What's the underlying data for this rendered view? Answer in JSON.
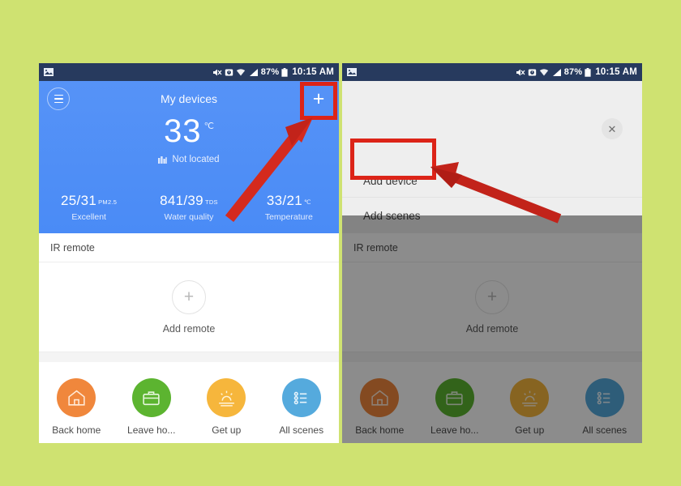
{
  "background_color": "#cfe271",
  "accent_red": "#dc2418",
  "status_bar": {
    "icons": [
      "image-icon",
      "mute-icon",
      "alarm-icon",
      "wifi-icon",
      "signal-icon"
    ],
    "battery_percent": "87%",
    "battery_icon": "battery-icon",
    "time": "10:15 AM"
  },
  "left_phone": {
    "header": {
      "menu_icon": "hamburger-menu-icon",
      "title": "My devices",
      "add_icon": "plus-icon",
      "temperature": "33",
      "temperature_unit": "℃",
      "location_icon": "city-icon",
      "location_text": "Not located",
      "stats": [
        {
          "value": "25/31",
          "unit": "PM2.5",
          "label": "Excellent"
        },
        {
          "value": "841/39",
          "unit": "TDS",
          "label": "Water quality"
        },
        {
          "value": "33/21",
          "unit": "℃",
          "label": "Temperature"
        }
      ]
    },
    "section_title": "IR remote",
    "add_remote": {
      "icon": "plus-icon",
      "label": "Add remote"
    },
    "scenes": [
      {
        "name": "Back home",
        "icon": "home-icon",
        "color": "#f0873c"
      },
      {
        "name": "Leave ho...",
        "icon": "briefcase-icon",
        "color": "#5cb430"
      },
      {
        "name": "Get up",
        "icon": "sunrise-icon",
        "color": "#f6b63c"
      },
      {
        "name": "All scenes",
        "icon": "list-icon",
        "color": "#55aadd"
      }
    ]
  },
  "right_phone": {
    "close_icon": "close-icon",
    "menu_items": [
      {
        "label": "Add device",
        "highlighted": true
      },
      {
        "label": "Add scenes",
        "highlighted": false
      }
    ],
    "section_title": "IR remote",
    "add_remote": {
      "icon": "plus-icon",
      "label": "Add remote"
    },
    "scenes": [
      {
        "name": "Back home",
        "icon": "home-icon",
        "color": "#f0873c"
      },
      {
        "name": "Leave ho...",
        "icon": "briefcase-icon",
        "color": "#5cb430"
      },
      {
        "name": "Get up",
        "icon": "sunrise-icon",
        "color": "#f6b63c"
      },
      {
        "name": "All scenes",
        "icon": "list-icon",
        "color": "#55aadd"
      }
    ]
  },
  "annotations": [
    {
      "name": "highlight-box-plus-button",
      "shape": "rectangle"
    },
    {
      "name": "arrow-to-plus-button",
      "shape": "arrow"
    },
    {
      "name": "highlight-box-add-device",
      "shape": "rectangle"
    },
    {
      "name": "arrow-to-add-device",
      "shape": "arrow"
    }
  ]
}
